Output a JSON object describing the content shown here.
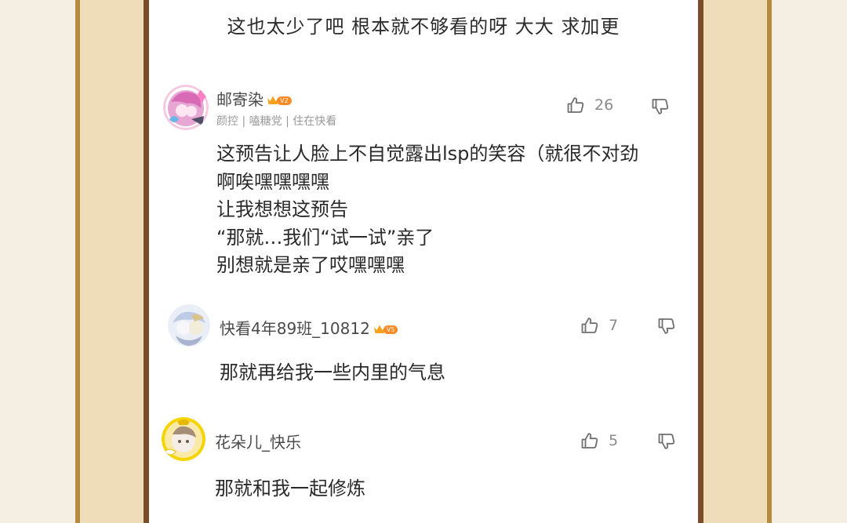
{
  "top_line": "这也太少了吧 根本就不够看的呀 大大 求加更",
  "comments": [
    {
      "username": "邮寄染",
      "vip": "V2",
      "tags": "颜控 | 嗑糖党 | 住在快看",
      "likes": "26",
      "lines": [
        "这预告让人脸上不自觉露出lsp的笑容（就很不对劲",
        "啊唉嘿嘿嘿嘿",
        "让我想想这预告",
        "“那就…我们“试一试”亲了",
        "别想就是亲了哎嘿嘿嘿"
      ]
    },
    {
      "username": "快看4年89班_10812",
      "vip": "V5",
      "likes": "7",
      "lines": [
        "那就再给我一些内里的气息"
      ]
    },
    {
      "username": "花朵儿_快乐",
      "likes": "5",
      "lines": [
        "那就和我一起修炼"
      ]
    }
  ],
  "colors": {
    "frame_gold": "#b78a3e",
    "frame_brown": "#7b4e2b",
    "vip_orange": "#ff8a26"
  },
  "icons": [
    "thumbs-up-icon",
    "thumbs-down-icon",
    "crown-icon"
  ]
}
